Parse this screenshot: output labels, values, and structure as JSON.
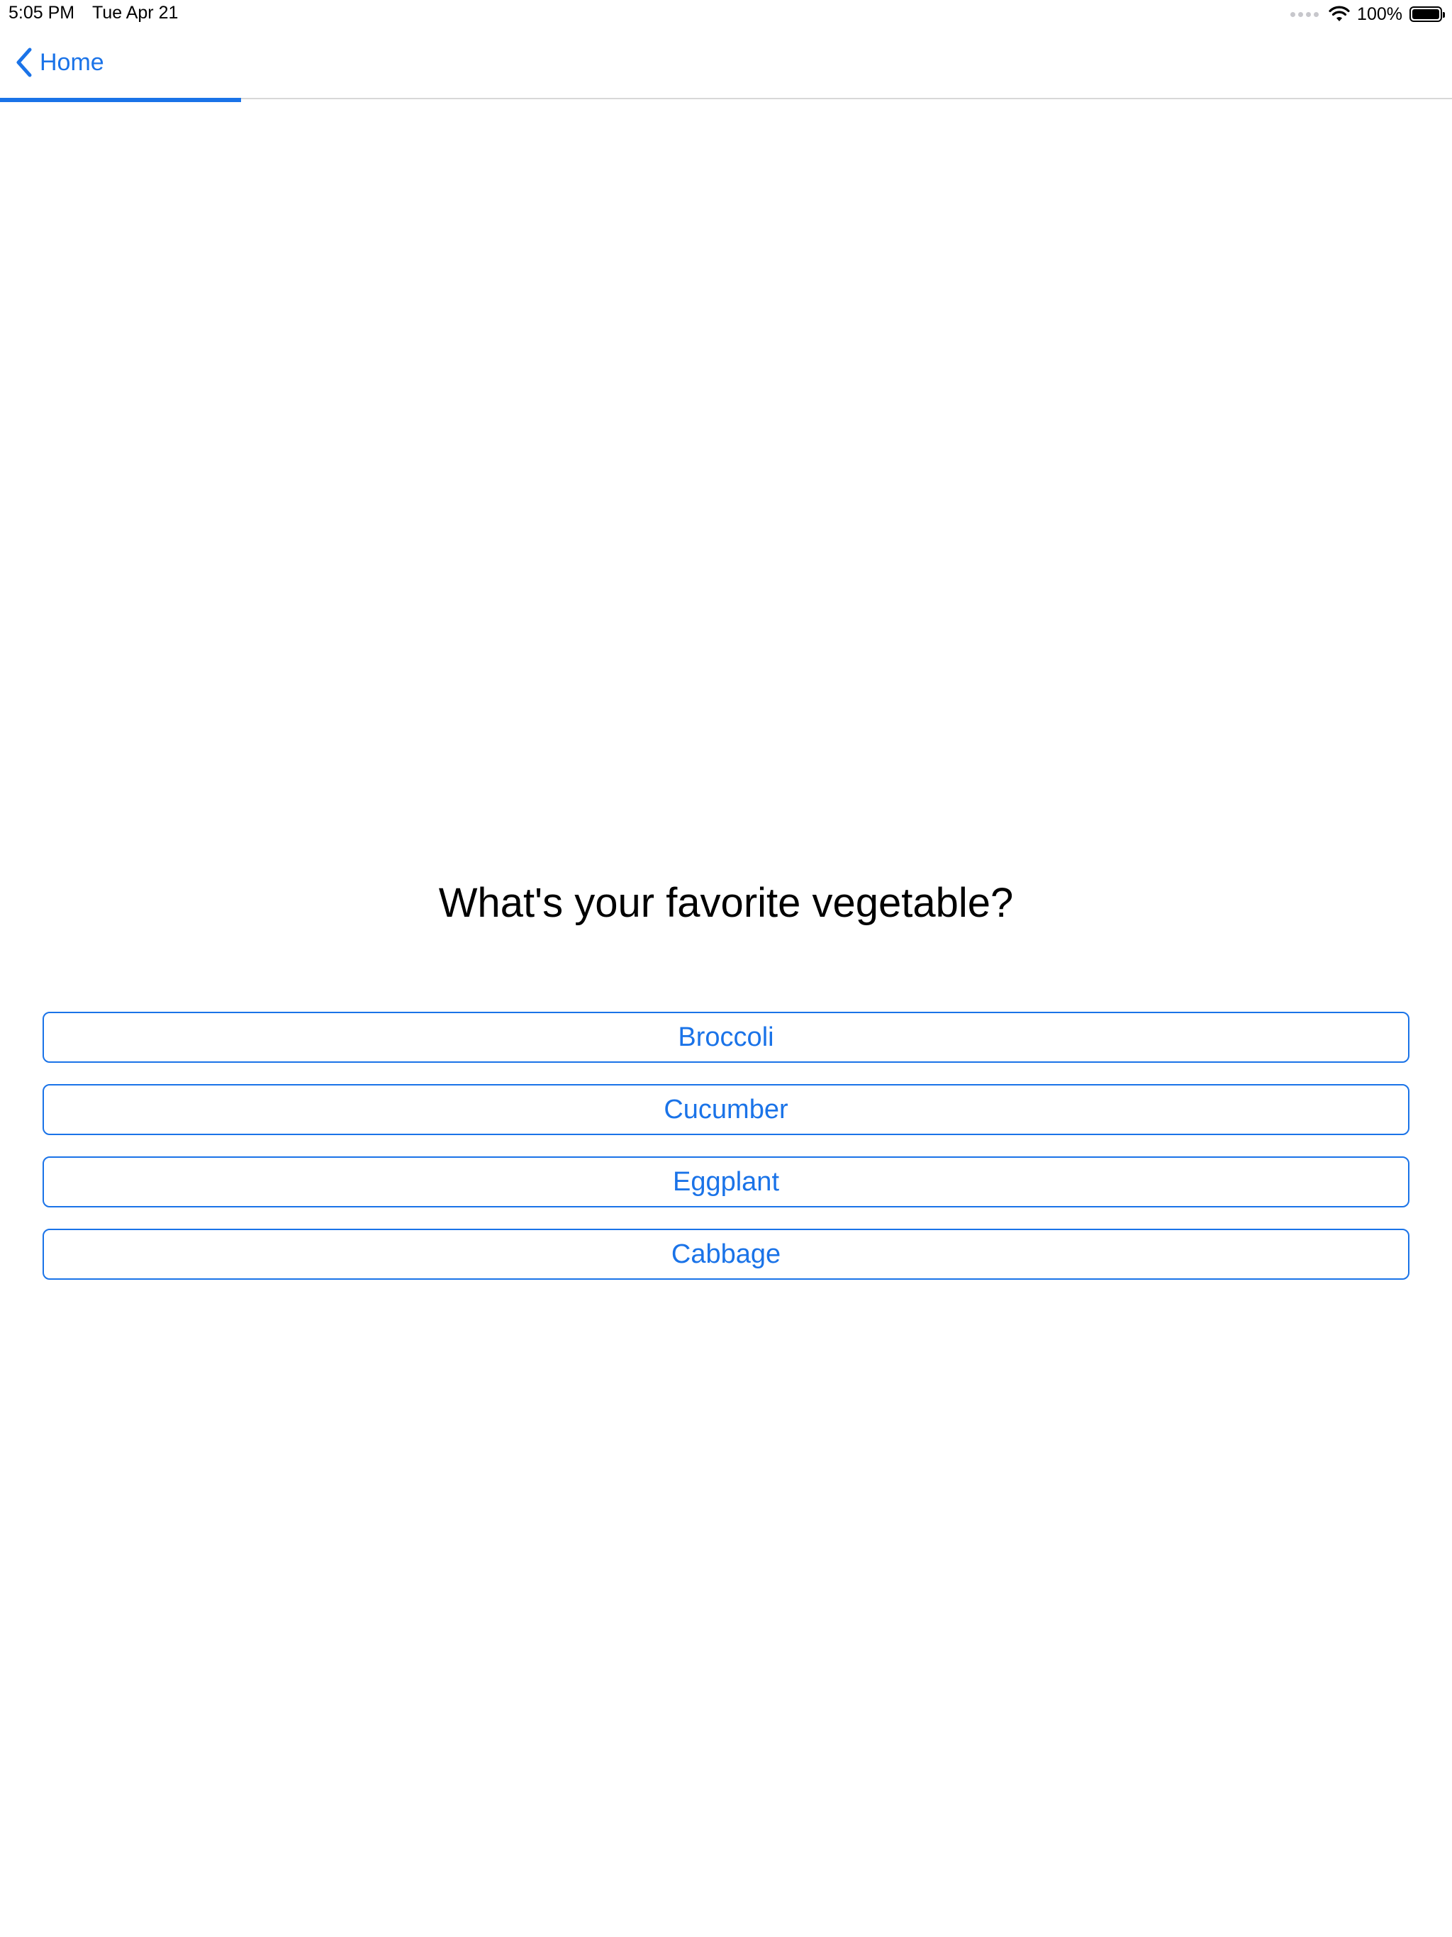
{
  "status_bar": {
    "time": "5:05 PM",
    "date": "Tue Apr 21",
    "battery_pct": "100%",
    "battery_level": 1.0,
    "icons": [
      "cellular-dots-icon",
      "wifi-icon",
      "battery-icon"
    ]
  },
  "nav": {
    "back_label": "Home",
    "back_icon": "chevron-left-icon",
    "progress_fraction": 0.166
  },
  "question": {
    "text": "What's your favorite vegetable?"
  },
  "answers": [
    {
      "label": "Broccoli"
    },
    {
      "label": "Cucumber"
    },
    {
      "label": "Eggplant"
    },
    {
      "label": "Cabbage"
    }
  ],
  "colors": {
    "accent": "#1a73e8",
    "text": "#000000",
    "divider": "#d8d8d8",
    "background": "#ffffff"
  }
}
